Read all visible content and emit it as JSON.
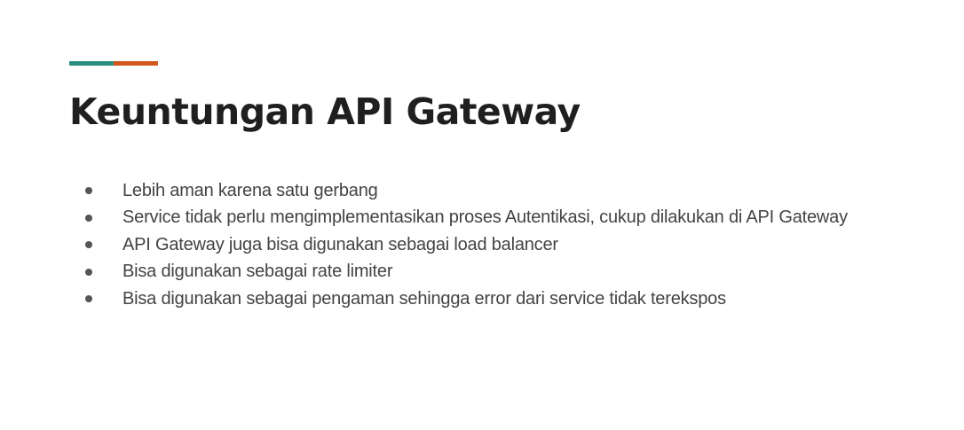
{
  "slide": {
    "title": "Keuntungan API Gateway",
    "accent_colors": [
      "#2a8f7f",
      "#d3571c"
    ],
    "bullets": [
      "Lebih aman karena satu gerbang",
      "Service tidak perlu mengimplementasikan proses Autentikasi, cukup dilakukan di API Gateway",
      "API Gateway juga bisa digunakan sebagai load balancer",
      "Bisa digunakan sebagai rate limiter",
      "Bisa digunakan sebagai pengaman sehingga error dari service tidak terekspos"
    ]
  }
}
